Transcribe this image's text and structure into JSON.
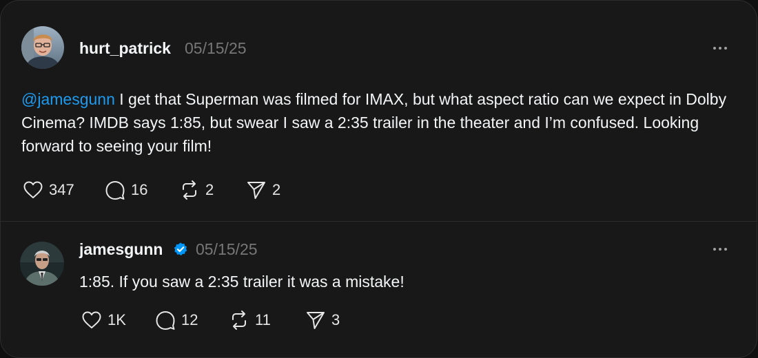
{
  "posts": [
    {
      "username": "hurt_patrick",
      "timestamp": "05/15/25",
      "verified": false,
      "mention": "@jamesgunn",
      "text": " I get that Superman was filmed for IMAX, but what aspect ratio can we expect in Dolby Cinema? IMDB says 1:85, but swear I saw a 2:35 trailer in the theater and I’m confused. Looking forward to seeing your film!",
      "likes": "347",
      "replies": "16",
      "reposts": "2",
      "shares": "2"
    },
    {
      "username": "jamesgunn",
      "timestamp": "05/15/25",
      "verified": true,
      "text": "1:85. If you saw a 2:35 trailer it was a mistake!",
      "likes": "1K",
      "replies": "12",
      "reposts": "11",
      "shares": "3"
    }
  ],
  "icons": {
    "like": "heart-icon",
    "reply": "comment-icon",
    "repost": "repost-icon",
    "share": "share-icon",
    "more": "more-icon",
    "verified": "verified-badge-icon"
  },
  "colors": {
    "background": "#181818",
    "text": "#f3f5f7",
    "muted": "#777777",
    "mention": "#1d9bf0",
    "verified": "#0095f6"
  }
}
